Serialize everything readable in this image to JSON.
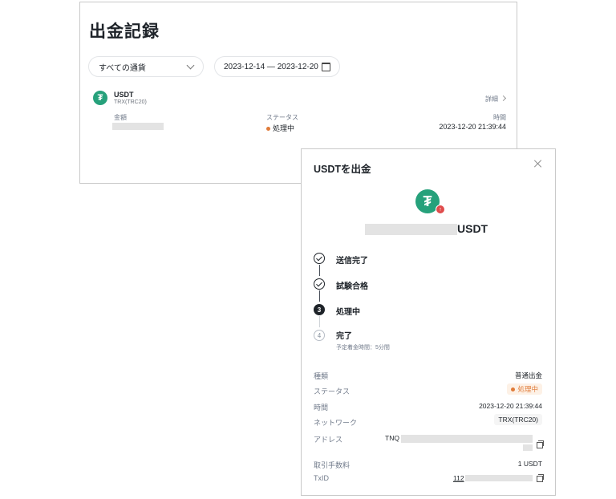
{
  "records": {
    "title": "出金記録",
    "currency_filter": "すべての通貨",
    "date_range": "2023-12-14 ― 2023-12-20",
    "item": {
      "coin": "USDT",
      "network": "TRX(TRC20)",
      "detail_link": "詳細",
      "amount_label": "金額",
      "status_label": "ステータス",
      "status_value": "処理中",
      "time_label": "時間",
      "time_value": "2023-12-20 21:39:44"
    }
  },
  "modal": {
    "title": "USDTを出金",
    "amount_unit": "USDT",
    "steps": [
      {
        "label": "送信完了",
        "state": "done"
      },
      {
        "label": "試験合格",
        "state": "done"
      },
      {
        "label": "処理中",
        "number": "3",
        "state": "active"
      },
      {
        "label": "完了",
        "number": "4",
        "state": "pending",
        "sub": "予定着金時間：5分間"
      }
    ],
    "details": {
      "type_label": "種類",
      "type_value": "普通出金",
      "status_label": "ステータス",
      "status_value": "処理中",
      "time_label": "時間",
      "time_value": "2023-12-20 21:39:44",
      "network_label": "ネットワーク",
      "network_value": "TRX(TRC20)",
      "address_label": "アドレス",
      "address_prefix": "TNQ",
      "fee_label": "取引手数料",
      "fee_value": "1 USDT",
      "txid_label": "TxID",
      "txid_prefix": "112"
    }
  },
  "colors": {
    "tether_green": "#26a17b",
    "status_orange": "#e07b39",
    "text": "#1e2329",
    "muted": "#707a8a"
  },
  "icons": [
    "chevron-down-icon",
    "calendar-icon",
    "tether-icon",
    "chevron-right-icon",
    "close-icon",
    "check-icon",
    "withdraw-badge-icon",
    "copy-icon"
  ]
}
